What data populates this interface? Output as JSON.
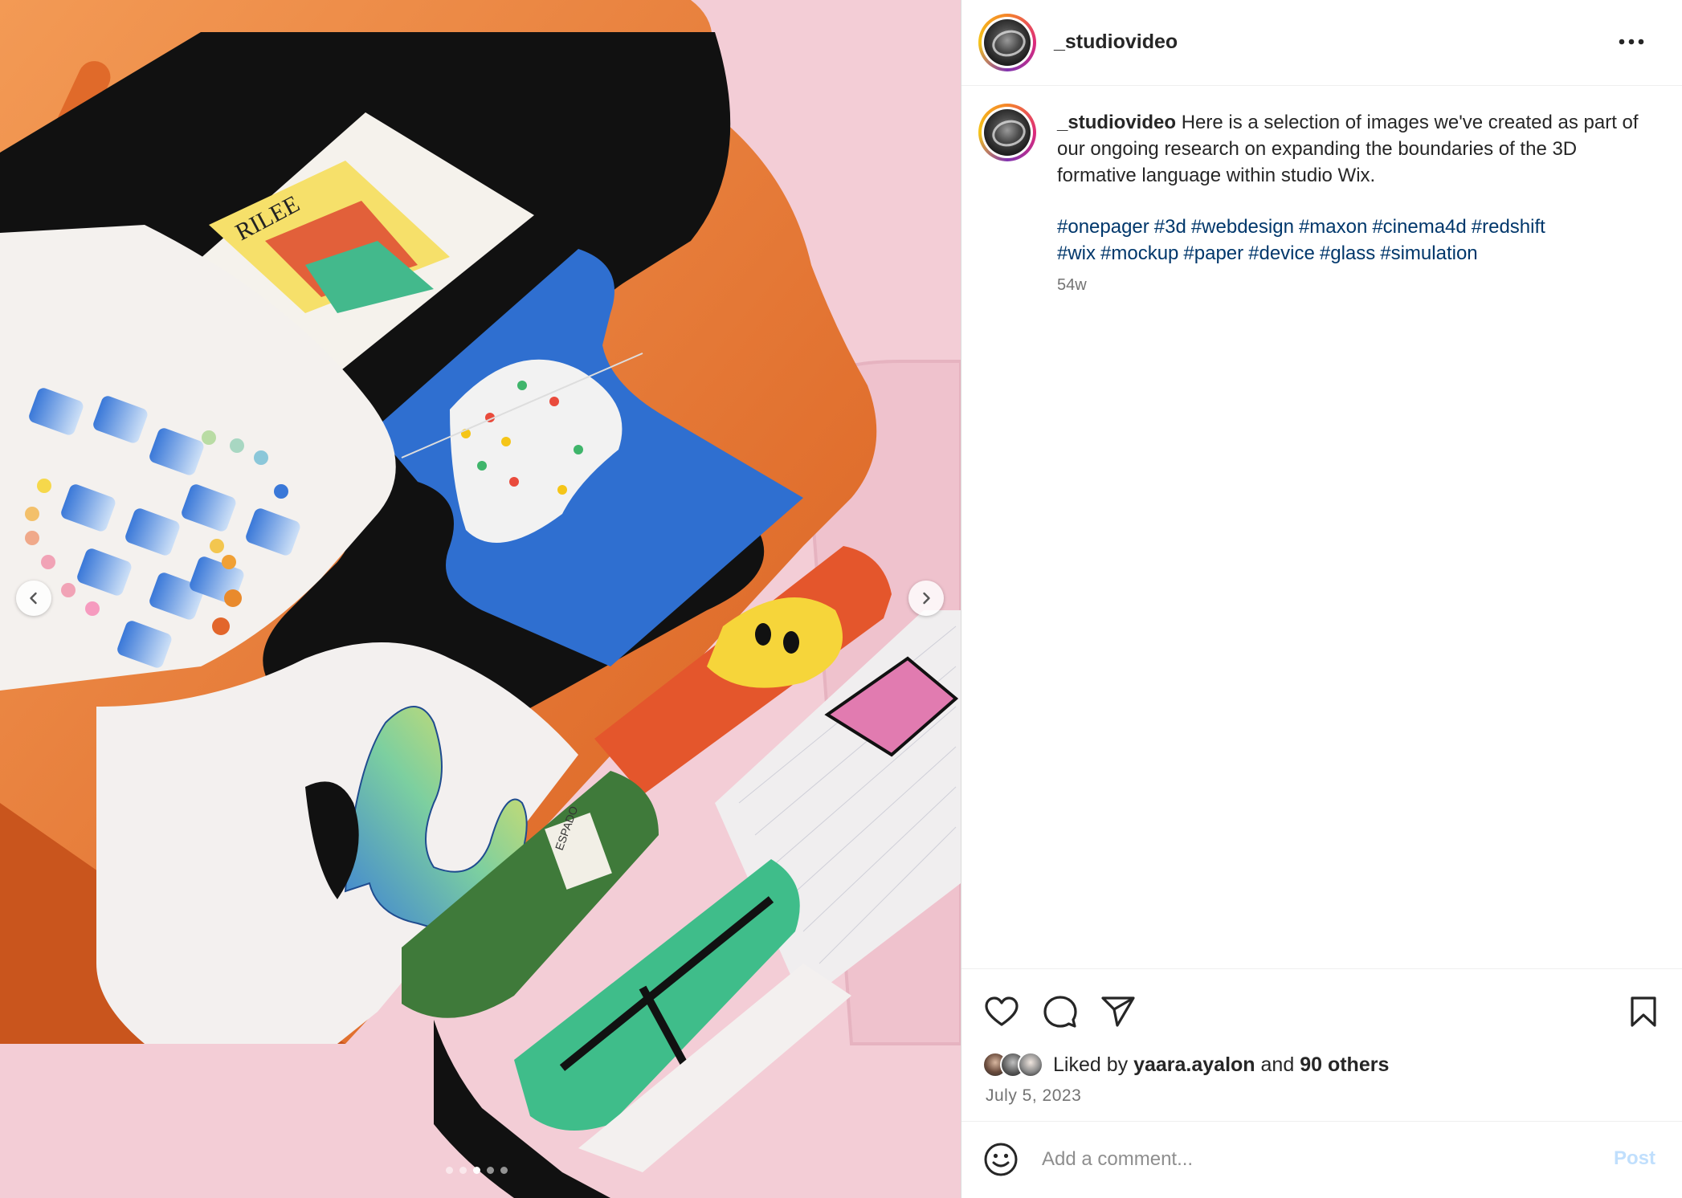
{
  "post": {
    "username": "_studiovideo",
    "caption": "Here is a selection of images we've created as part of our ongoing research on expanding the boundaries of the 3D formative language within studio Wix.",
    "hashtags": [
      "#onepager",
      "#3d",
      "#webdesign",
      "#maxon",
      "#cinema4d",
      "#redshift",
      "#wix",
      "#mockup",
      "#paper",
      "#device",
      "#glass",
      "#simulation"
    ],
    "time_ago": "54w",
    "liked_by_prefix": "Liked by",
    "liked_by_user": "yaara.ayalon",
    "liked_by_and": "and",
    "liked_by_others": "90 others",
    "date": "July 5, 2023"
  },
  "media": {
    "carousel_dots": 5,
    "active_dot_index": 2,
    "artwork_text": {
      "poster_letters": "RILEE",
      "bag_label": "ESPADO"
    }
  },
  "comment_box": {
    "placeholder": "Add a comment...",
    "post_label": "Post"
  },
  "icons": {
    "more": "more-horizontal-icon",
    "like": "heart-icon",
    "comment": "comment-bubble-icon",
    "share": "paper-plane-icon",
    "save": "bookmark-icon",
    "emoji": "emoji-smile-icon",
    "prev": "chevron-left-icon",
    "next": "chevron-right-icon"
  },
  "colors": {
    "link": "#00376b",
    "muted": "#737373",
    "post_button": "#c0dffd",
    "media_bg": "#f4cfd8",
    "device_orange": "#e8722e"
  }
}
